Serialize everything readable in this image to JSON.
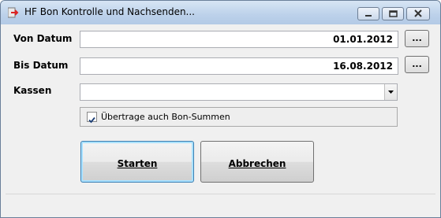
{
  "window": {
    "title": "HF Bon Kontrolle und Nachsenden..."
  },
  "form": {
    "von_label": "Von Datum",
    "von_value": "01.01.2012",
    "bis_label": "Bis Datum",
    "bis_value": "16.08.2012",
    "kassen_label": "Kassen",
    "kassen_value": "",
    "dots_label": "...",
    "checkbox_label": "Übertrage auch Bon-Summen",
    "checkbox_checked": true
  },
  "buttons": {
    "start": "Starten",
    "cancel": "Abbrechen"
  }
}
